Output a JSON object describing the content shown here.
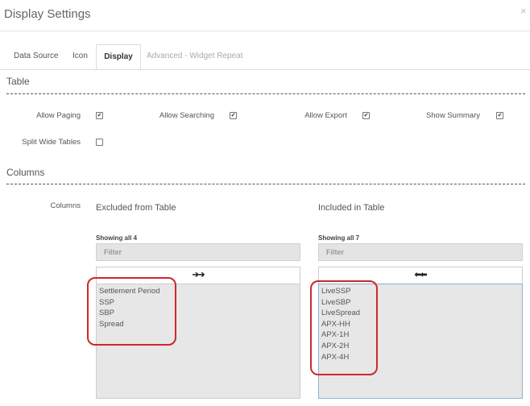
{
  "dialog": {
    "title": "Display Settings",
    "close_label": "×"
  },
  "tabs": [
    {
      "label": "Data Source",
      "active": false
    },
    {
      "label": "Icon",
      "active": false
    },
    {
      "label": "Display",
      "active": true
    },
    {
      "label": "Advanced - Widget Repeat",
      "active": false
    }
  ],
  "table_section": {
    "heading": "Table",
    "options": [
      {
        "label": "Allow Paging",
        "checked": true
      },
      {
        "label": "Allow Searching",
        "checked": true
      },
      {
        "label": "Allow Export",
        "checked": true
      },
      {
        "label": "Show Summary",
        "checked": true
      },
      {
        "label": "Split Wide Tables",
        "checked": false
      }
    ]
  },
  "columns_section": {
    "heading": "Columns",
    "row_label": "Columns",
    "excluded": {
      "heading": "Excluded from Table",
      "showing": "Showing all 4",
      "filter_placeholder": "Filter",
      "move_label": "➔➔",
      "items": [
        "Settlement Period",
        "SSP",
        "SBP",
        "Spread"
      ]
    },
    "included": {
      "heading": "Included in Table",
      "showing": "Showing all 7",
      "filter_placeholder": "Filter",
      "move_label": "⬅⬅",
      "items": [
        "LiveSSP",
        "LiveSBP",
        "LiveSpread",
        "APX-HH",
        "APX-1H",
        "APX-2H",
        "APX-4H"
      ]
    }
  },
  "colors": {
    "highlight": "#d0262c",
    "list_bg": "#e7e7e7",
    "filter_bg": "#e4e4e4"
  }
}
